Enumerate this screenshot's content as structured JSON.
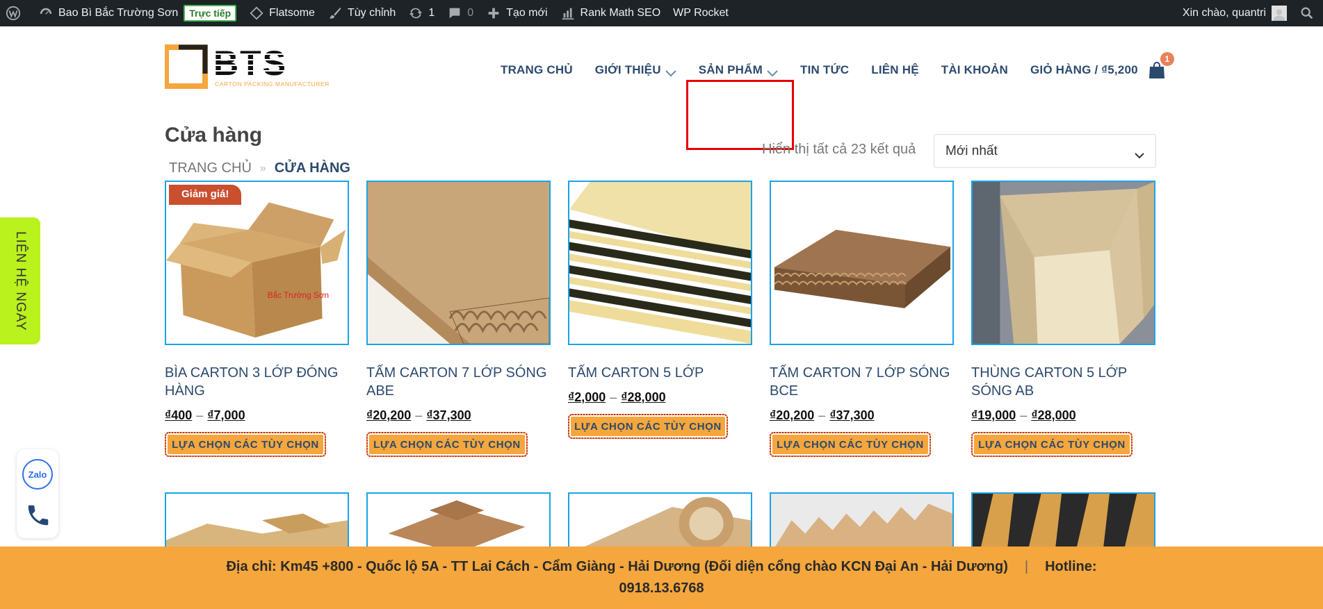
{
  "admin_bar": {
    "site_name": "Bao Bì Bắc Trường Sơn",
    "live_badge": "Trực tiếp",
    "theme": "Flatsome",
    "customize": "Tùy chỉnh",
    "updates_count": "1",
    "comments_count": "0",
    "new": "Tạo mới",
    "rank_math": "Rank Math SEO",
    "wp_rocket": "WP Rocket",
    "greeting": "Xin chào, quantri"
  },
  "header": {
    "logo_text": "BTS",
    "logo_tagline": "CARTON PACKING MANUFACTURER",
    "nav": [
      {
        "label": "TRANG CHỦ"
      },
      {
        "label": "GIỚI THIỆU"
      },
      {
        "label": "SẢN PHẨM"
      },
      {
        "label": "TIN TỨC"
      },
      {
        "label": "LIÊN HỆ"
      },
      {
        "label": "TÀI KHOẢN"
      },
      {
        "label": "GIỎ HÀNG / ₫5,200"
      }
    ],
    "cart_count": "1"
  },
  "shop": {
    "title": "Cửa hàng",
    "breadcrumb_home": "TRANG CHỦ",
    "breadcrumb_sep": "»",
    "breadcrumb_current": "CỬA HÀNG",
    "result_count": "Hiển thị tất cả 23 kết quả",
    "sort_selected": "Mới nhất"
  },
  "products": [
    {
      "name": "BÌA CARTON 3 LỚP ĐÓNG HÀNG",
      "price_min": "₫400",
      "price_max": "₫7,000",
      "sale_badge": "Giảm giá!",
      "watermark": "Bắc Trường Sơn",
      "button": "LỰA CHỌN CÁC TÙY CHỌN"
    },
    {
      "name": "TẤM CARTON 7 LỚP SÓNG ABE",
      "price_min": "₫20,200",
      "price_max": "₫37,300",
      "button": "LỰA CHỌN CÁC TÙY CHỌN"
    },
    {
      "name": "TẤM CARTON 5 LỚP",
      "price_min": "₫2,000",
      "price_max": "₫28,000",
      "button": "LỰA CHỌN CÁC TÙY CHỌN"
    },
    {
      "name": "TẤM CARTON 7 LỚP SÓNG BCE",
      "price_min": "₫20,200",
      "price_max": "₫37,300",
      "button": "LỰA CHỌN CÁC TÙY CHỌN"
    },
    {
      "name": "THÙNG CARTON 5 LỚP SÓNG AB",
      "price_min": "₫19,000",
      "price_max": "₫28,000",
      "button": "LỰA CHỌN CÁC TÙY CHỌN"
    }
  ],
  "side_contact": "LIÊN HỆ NGAY",
  "zalo_label": "Zalo",
  "footer": {
    "address": "Địa chỉ: Km45 +800 - Quốc lộ 5A - TT Lai Cách - Cẩm Giàng - Hải Dương (Đối diện cổng chào KCN Đại An - Hải Dương)",
    "pipe": "|",
    "hotline_label": "Hotline:",
    "hotline": "0918.13.6768"
  },
  "colors": {
    "admin_bg": "#1d2327",
    "nav_text": "#2c4a6e",
    "accent_orange": "#f5a63c",
    "product_border": "#1aa3e8",
    "sale_badge": "#c94f2e",
    "side_contact": "#b9f21c",
    "highlight": "#e80000"
  }
}
